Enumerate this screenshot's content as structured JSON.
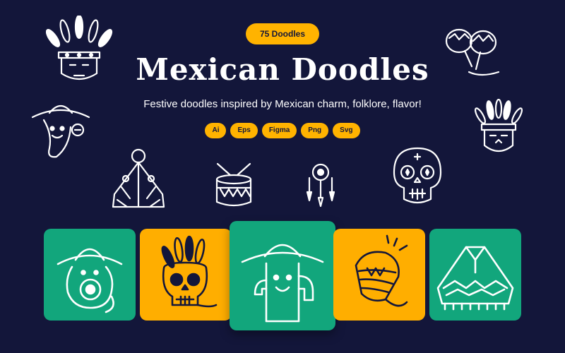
{
  "badge": {
    "count_label": "75 Doodles"
  },
  "header": {
    "title": "Mexican Doodles",
    "subtitle": "Festive doodles inspired by Mexican charm, folklore, flavor!"
  },
  "formats": [
    "Ai",
    "Eps",
    "Figma",
    "Png",
    "Svg"
  ],
  "colors": {
    "background": "#13163a",
    "accent": "#ffb300",
    "green": "#12a67c",
    "orange": "#ffae00",
    "ink": "#ffffff"
  },
  "doodles": [
    "feather-headdress-mask",
    "sombrero-pepper",
    "poncho-cape",
    "drum",
    "dreamcatcher",
    "sugar-skull",
    "maracas",
    "feather-mask"
  ],
  "cards": [
    "sombrero-guitar",
    "feather-skull",
    "sombrero-cactus",
    "pinata-top",
    "poncho"
  ]
}
